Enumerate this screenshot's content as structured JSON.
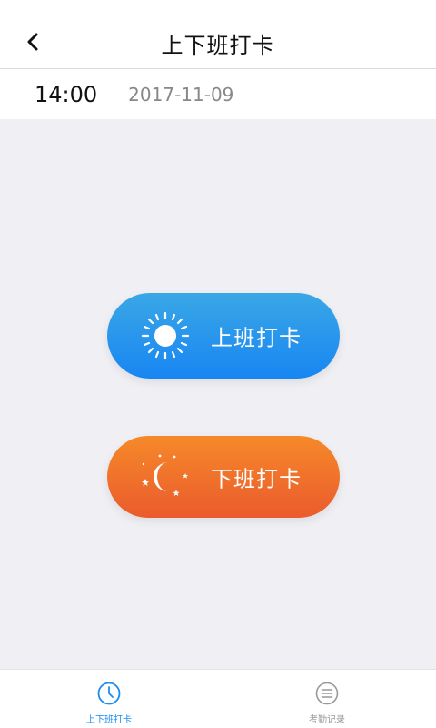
{
  "header": {
    "title": "上下班打卡",
    "back_icon": "chevron-left-icon"
  },
  "datetime": {
    "time": "14:00",
    "date": "2017-11-09"
  },
  "buttons": {
    "clock_in": {
      "label": "上班打卡",
      "icon": "sun-icon",
      "colors": [
        "#3aa7e6",
        "#1886f2"
      ]
    },
    "clock_out": {
      "label": "下班打卡",
      "icon": "moon-stars-icon",
      "colors": [
        "#f6892a",
        "#ea5b2c"
      ]
    }
  },
  "tabbar": {
    "active_color": "#1b8cf0",
    "inactive_color": "#999999",
    "tabs": [
      {
        "label": "上下班打卡",
        "icon": "clock-icon",
        "active": true
      },
      {
        "label": "考勤记录",
        "icon": "list-icon",
        "active": false
      }
    ]
  }
}
